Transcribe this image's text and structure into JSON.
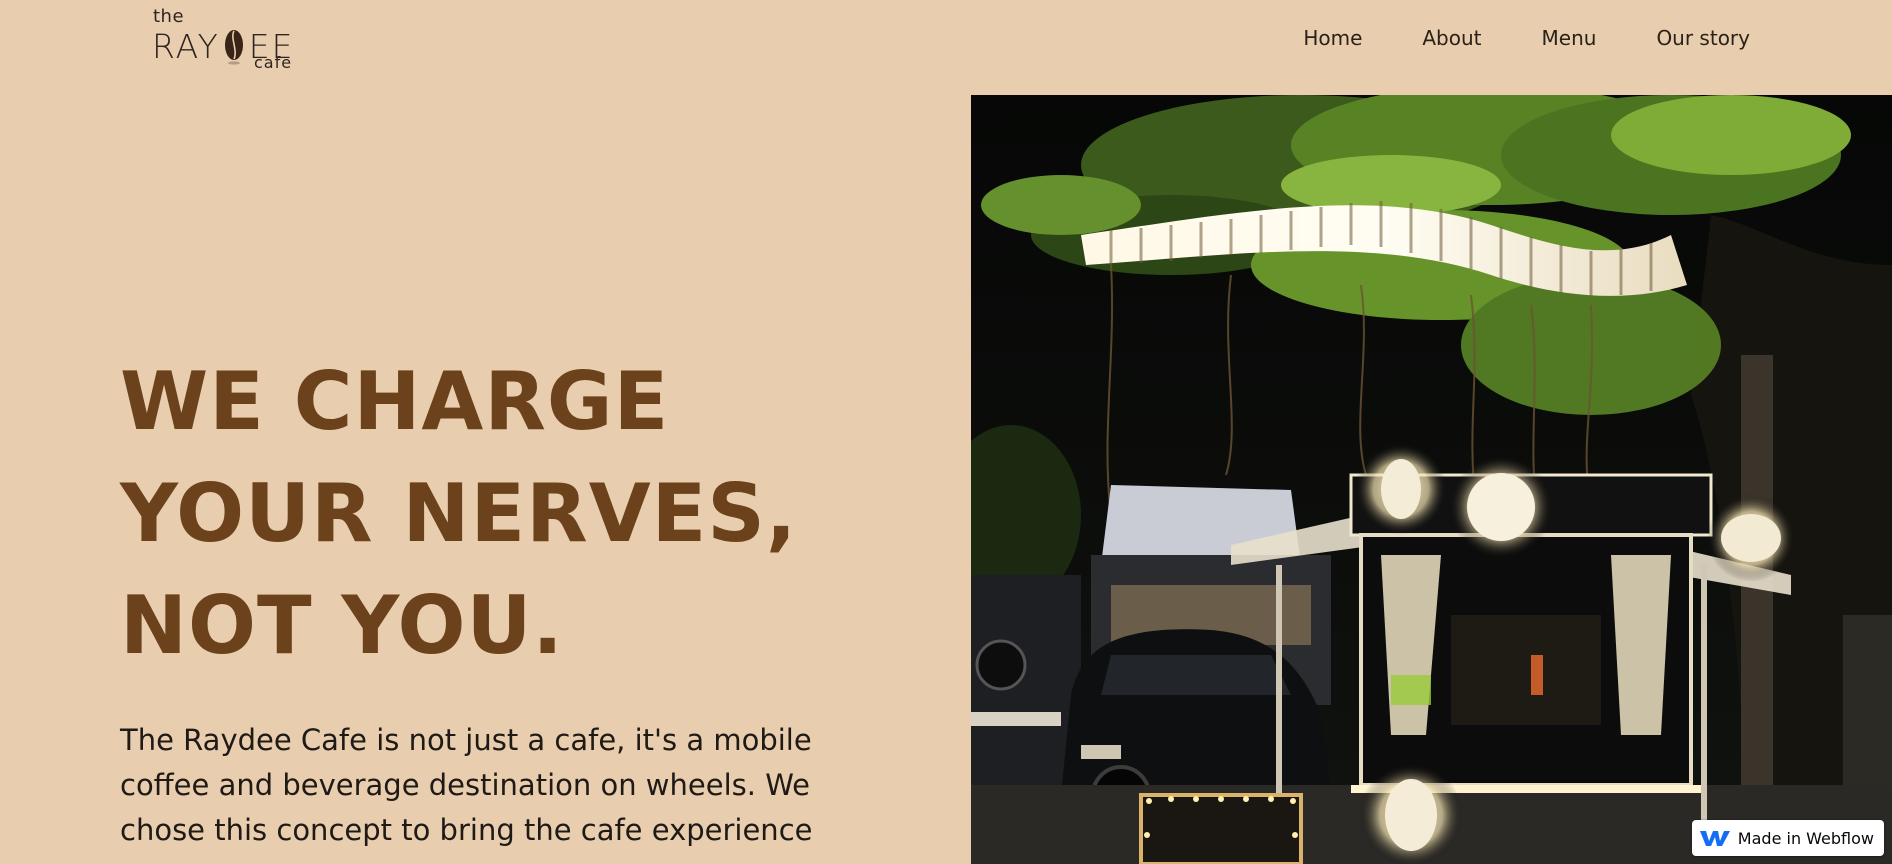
{
  "logo": {
    "the": "the",
    "word_left": "RAY",
    "word_right": "EE",
    "cafe": "cafe"
  },
  "nav": {
    "items": [
      "Home",
      "About",
      "Menu",
      "Our story"
    ]
  },
  "hero": {
    "headline_lines": [
      "WE CHARGE",
      "YOUR NERVES,",
      "NOT YOU."
    ],
    "intro": "The Raydee Cafe is not just a cafe, it's a mobile coffee and beverage destination on wheels. We chose this concept to bring the cafe experience"
  },
  "badge": {
    "label": "Made in Webflow"
  },
  "colors": {
    "background": "#e8cdae",
    "headline": "#6b421c",
    "text": "#1f1a16"
  }
}
